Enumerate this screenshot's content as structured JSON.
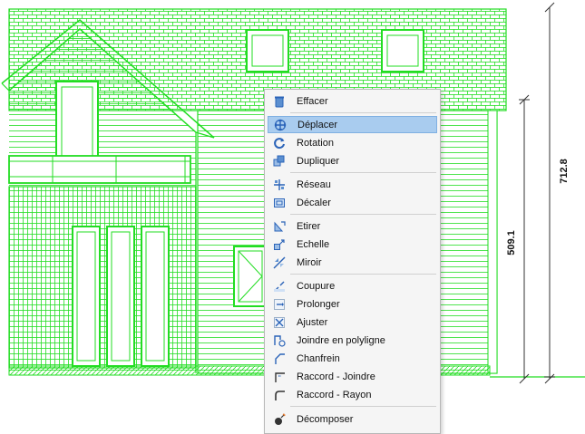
{
  "dimensions": {
    "total_height": "712.8",
    "wall_height": "509.1"
  },
  "colors": {
    "drawing_line": "#22dd22",
    "menu_bg": "#f5f5f5",
    "menu_highlight": "#a9ccef",
    "icon_blue": "#2a63b8"
  },
  "context_menu": {
    "items": [
      {
        "label": "Effacer",
        "icon": "trash-icon",
        "highlighted": false
      },
      {
        "label": "Déplacer",
        "icon": "move-icon",
        "highlighted": true
      },
      {
        "label": "Rotation",
        "icon": "rotate-icon",
        "highlighted": false
      },
      {
        "label": "Dupliquer",
        "icon": "duplicate-icon",
        "highlighted": false
      },
      {
        "label": "Réseau",
        "icon": "array-icon",
        "highlighted": false
      },
      {
        "label": "Décaler",
        "icon": "offset-icon",
        "highlighted": false
      },
      {
        "label": "Etirer",
        "icon": "stretch-icon",
        "highlighted": false
      },
      {
        "label": "Echelle",
        "icon": "scale-icon",
        "highlighted": false
      },
      {
        "label": "Miroir",
        "icon": "mirror-icon",
        "highlighted": false
      },
      {
        "label": "Coupure",
        "icon": "break-icon",
        "highlighted": false
      },
      {
        "label": "Prolonger",
        "icon": "extend-icon",
        "highlighted": false
      },
      {
        "label": "Ajuster",
        "icon": "trim-icon",
        "highlighted": false
      },
      {
        "label": "Joindre en polyligne",
        "icon": "join-polyline-icon",
        "highlighted": false
      },
      {
        "label": "Chanfrein",
        "icon": "chamfer-icon",
        "highlighted": false
      },
      {
        "label": "Raccord - Joindre",
        "icon": "fillet-join-icon",
        "highlighted": false
      },
      {
        "label": "Raccord - Rayon",
        "icon": "fillet-radius-icon",
        "highlighted": false
      },
      {
        "label": "Décomposer",
        "icon": "explode-icon",
        "highlighted": false
      }
    ]
  }
}
